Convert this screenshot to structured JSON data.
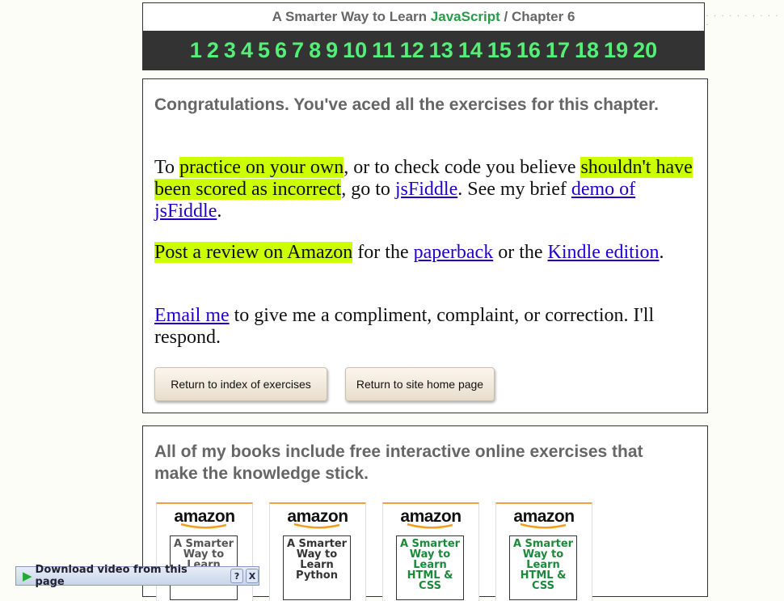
{
  "header": {
    "title_prefix": "A Smarter Way to Learn",
    "title_js": "JavaScript",
    "title_sep": " / ",
    "title_chapter": "Chapter 6",
    "chapters": [
      "1",
      "2",
      "3",
      "4",
      "5",
      "6",
      "7",
      "8",
      "9",
      "10",
      "11",
      "12",
      "13",
      "14",
      "15",
      "16",
      "17",
      "18",
      "19",
      "20"
    ]
  },
  "main": {
    "congrats": "Congratulations. You've aced all the exercises for this chapter.",
    "p1": {
      "t1": "To ",
      "h1": "practice on your own",
      "t2": ", or to check code you believe ",
      "h2": "shouldn't have been scored as incorrect",
      "t3": ", go to ",
      "link1": "jsFiddle",
      "t4": ". See my brief ",
      "link2": "demo of jsFiddle",
      "t5": "."
    },
    "p2": {
      "h1": "Post a review on Amazon",
      "t1": " for the ",
      "link1": "paperback",
      "t2": " or the ",
      "link2": "Kindle edition",
      "t3": "."
    },
    "p3": {
      "link1": "Email me",
      "t1": " to give me a compliment, complaint, or correction. I'll respond."
    },
    "btn_index": "Return to index of exercises",
    "btn_home": "Return to site home page"
  },
  "books": {
    "heading": "All of my books include free interactive online exercises that make the knowledge stick.",
    "amazon_label": "amazon",
    "items": [
      {
        "cover": "A Smarter Way to Learn",
        "color": "#555555"
      },
      {
        "cover": "A Smarter Way to Learn Python",
        "color": "#333333"
      },
      {
        "cover": "A Smarter Way to Learn HTML & CSS",
        "color": "#1a8a3a"
      },
      {
        "cover": "A Smarter Way to Learn HTML & CSS",
        "color": "#1a8a3a"
      }
    ]
  },
  "download_bar": {
    "label": "Download video from this page",
    "help": "?",
    "close": "X"
  }
}
